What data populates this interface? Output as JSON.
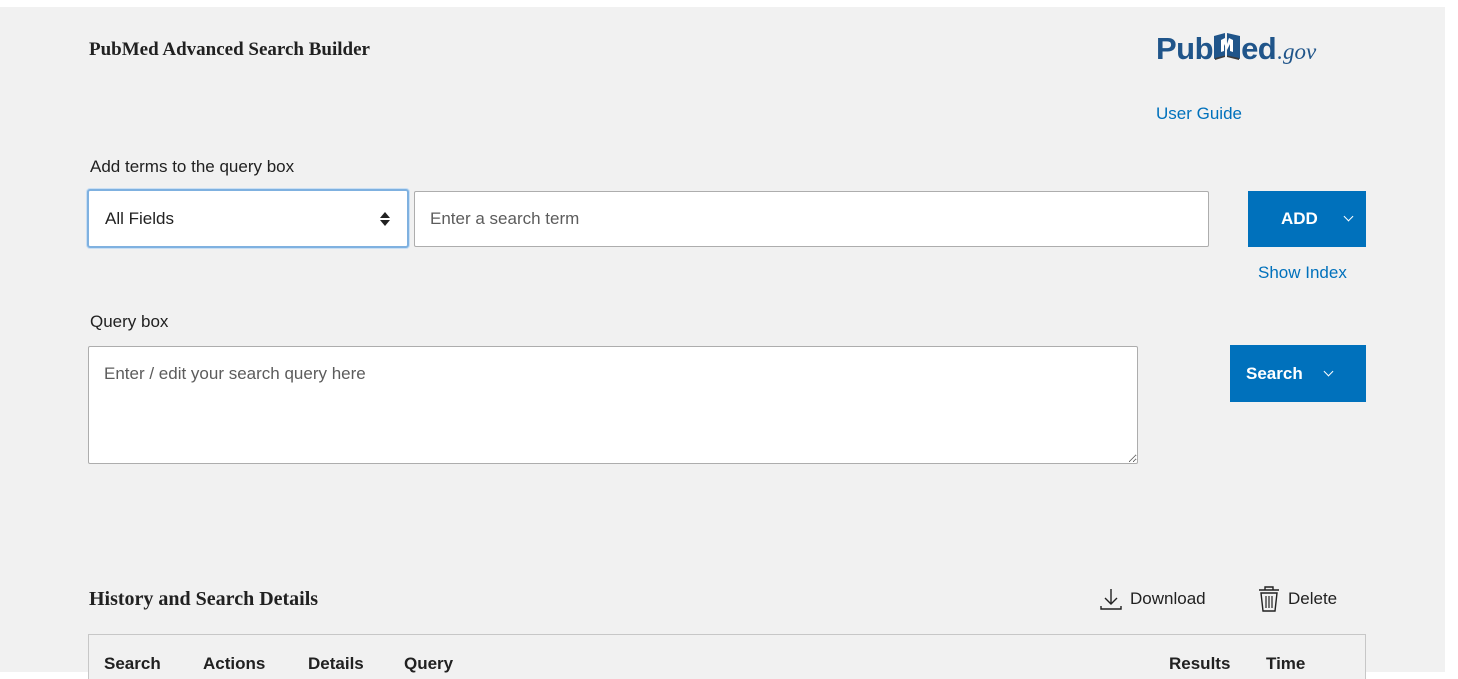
{
  "header": {
    "title": "PubMed Advanced Search Builder",
    "logo": {
      "part1": "Pub",
      "part2": "ed",
      "suffix": ".gov",
      "icon": "open-book-icon",
      "brand_color": "#20558a"
    },
    "user_guide_link": "User Guide"
  },
  "builder": {
    "label": "Add terms to the query box",
    "field_select": {
      "selected": "All Fields"
    },
    "term_input": {
      "placeholder": "Enter a search term",
      "value": ""
    },
    "add_button": "ADD",
    "show_index_link": "Show Index"
  },
  "query": {
    "label": "Query box",
    "placeholder": "Enter / edit your search query here",
    "value": "",
    "search_button": "Search"
  },
  "history": {
    "title": "History and Search Details",
    "download_label": "Download",
    "delete_label": "Delete",
    "columns": [
      "Search",
      "Actions",
      "Details",
      "Query",
      "Results",
      "Time"
    ]
  },
  "colors": {
    "accent": "#0071bc",
    "background": "#f1f1f1",
    "text": "#212121"
  }
}
